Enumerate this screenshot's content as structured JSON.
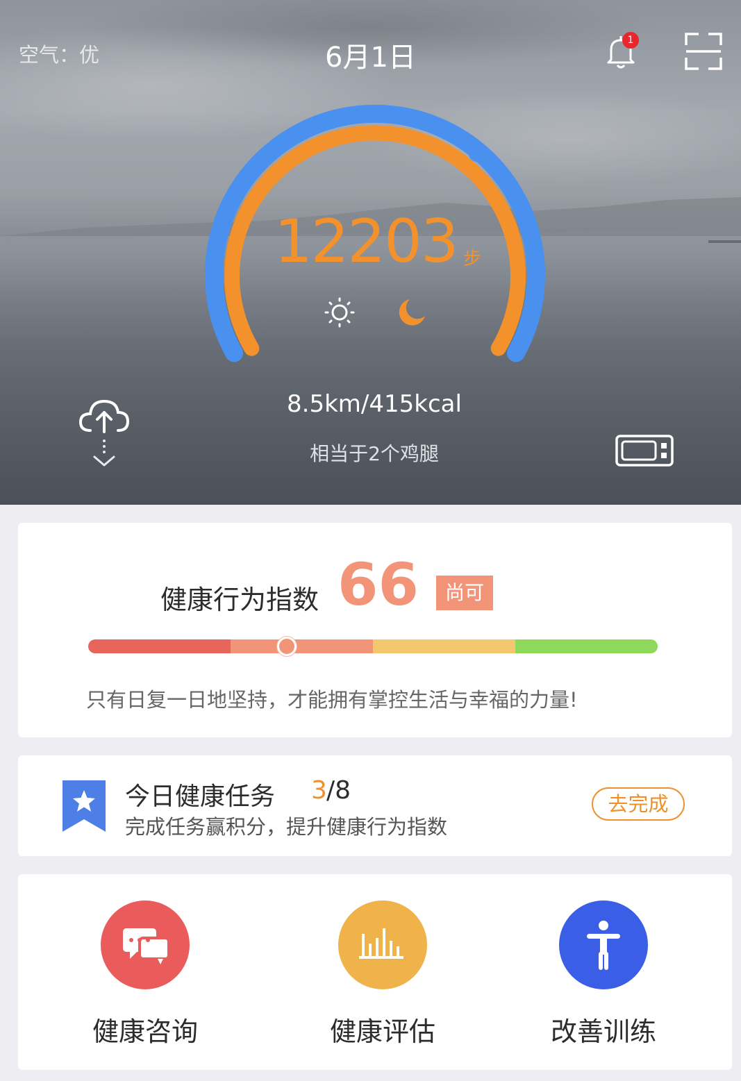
{
  "header": {
    "air_quality": "空气：优",
    "date": "6月1日",
    "notification_count": "1"
  },
  "activity": {
    "steps": "12203",
    "steps_unit": "步",
    "steps_progress": 0.83,
    "distance_calories": "8.5km/415kcal",
    "equivalent": "相当于2个鸡腿"
  },
  "health_index": {
    "label": "健康行为指数",
    "score": "66",
    "grade": "尚可",
    "colors": [
      "#e7655a",
      "#f29478",
      "#f29478",
      "#f3c76d",
      "#8ed85c"
    ],
    "motto": "只有日复一日地坚持，才能拥有掌控生活与幸福的力量!"
  },
  "daily_task": {
    "title": "今日健康任务",
    "done": "3",
    "total": "/8",
    "subtitle": "完成任务赢积分，提升健康行为指数",
    "button": "去完成"
  },
  "features": [
    {
      "label": "健康咨询",
      "icon": "chat-bubbles-icon",
      "color": "#ea5c5c"
    },
    {
      "label": "健康评估",
      "icon": "bar-chart-icon",
      "color": "#f0b34c"
    },
    {
      "label": "改善训练",
      "icon": "person-icon",
      "color": "#3a5fe6"
    }
  ]
}
